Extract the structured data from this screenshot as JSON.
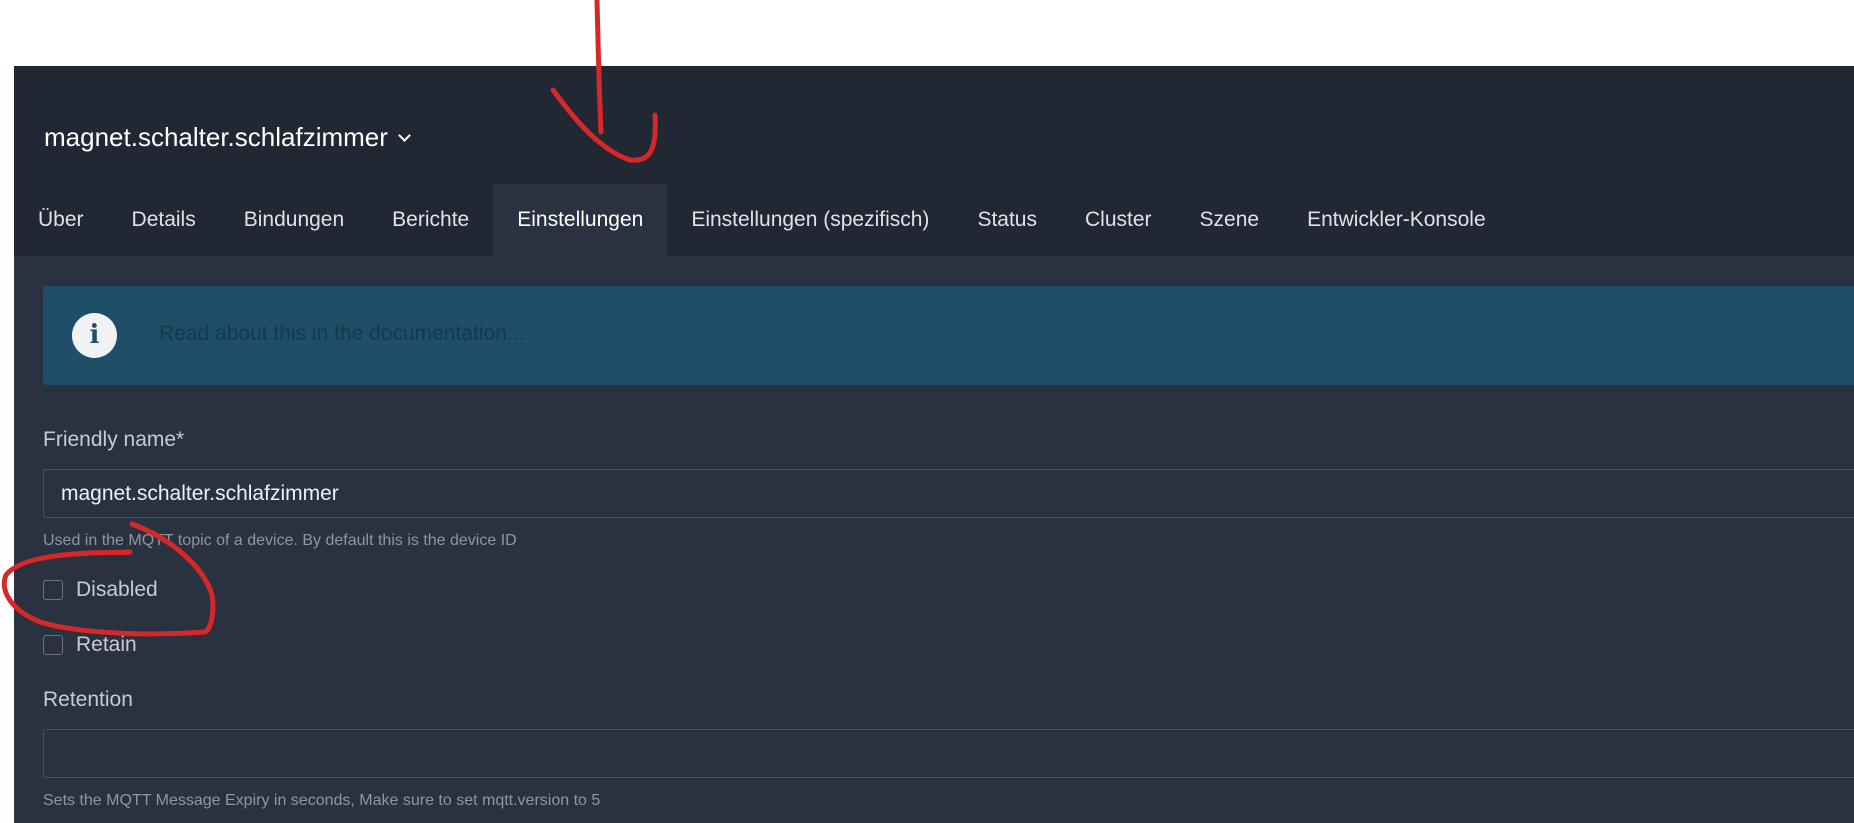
{
  "header": {
    "device_name": "magnet.schalter.schlafzimmer"
  },
  "tabs": [
    {
      "label": "Über",
      "active": false
    },
    {
      "label": "Details",
      "active": false
    },
    {
      "label": "Bindungen",
      "active": false
    },
    {
      "label": "Berichte",
      "active": false
    },
    {
      "label": "Einstellungen",
      "active": true
    },
    {
      "label": "Einstellungen (spezifisch)",
      "active": false
    },
    {
      "label": "Status",
      "active": false
    },
    {
      "label": "Cluster",
      "active": false
    },
    {
      "label": "Szene",
      "active": false
    },
    {
      "label": "Entwickler-Konsole",
      "active": false
    }
  ],
  "info": {
    "icon": "i",
    "link_text": "Read about this in the documentation..."
  },
  "form": {
    "friendly_name": {
      "label": "Friendly name*",
      "value": "magnet.schalter.schlafzimmer",
      "help": "Used in the MQTT topic of a device. By default this is the device ID"
    },
    "disabled": {
      "label": "Disabled",
      "checked": false
    },
    "retain": {
      "label": "Retain",
      "checked": false
    },
    "retention": {
      "label": "Retention",
      "value": "",
      "help": "Sets the MQTT Message Expiry in seconds, Make sure to set mqtt.version to 5"
    }
  },
  "colors": {
    "header_bg": "#212733",
    "content_bg": "#2a3140",
    "info_bg": "#1f4e68",
    "annotation": "#d62828"
  }
}
